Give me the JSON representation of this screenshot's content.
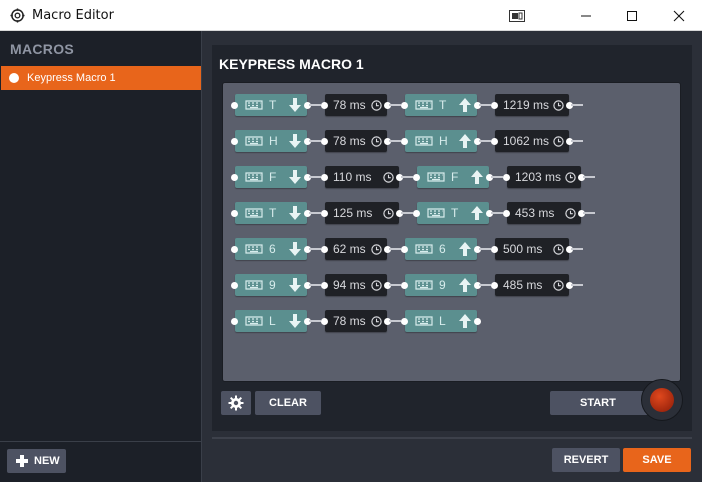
{
  "window": {
    "title": "Macro Editor",
    "icon": "gear-app-icon"
  },
  "sidebar": {
    "title": "MACROS",
    "items": [
      {
        "label": "Keypress Macro 1",
        "selected": true
      }
    ],
    "new_label": "NEW"
  },
  "editor": {
    "title": "KEYPRESS MACRO 1",
    "events": [
      {
        "type": "key",
        "key": "T",
        "dir": "down"
      },
      {
        "type": "delay",
        "label": "78 ms"
      },
      {
        "type": "key",
        "key": "T",
        "dir": "up"
      },
      {
        "type": "delay",
        "label": "1219 ms"
      },
      {
        "type": "key",
        "key": "H",
        "dir": "down"
      },
      {
        "type": "delay",
        "label": "78 ms"
      },
      {
        "type": "key",
        "key": "H",
        "dir": "up"
      },
      {
        "type": "delay",
        "label": "1062 ms"
      },
      {
        "type": "key",
        "key": "F",
        "dir": "down"
      },
      {
        "type": "delay",
        "label": "110 ms"
      },
      {
        "type": "key",
        "key": "F",
        "dir": "up"
      },
      {
        "type": "delay",
        "label": "1203 ms"
      },
      {
        "type": "key",
        "key": "T",
        "dir": "down"
      },
      {
        "type": "delay",
        "label": "125 ms"
      },
      {
        "type": "key",
        "key": "T",
        "dir": "up"
      },
      {
        "type": "delay",
        "label": "453 ms"
      },
      {
        "type": "key",
        "key": "6",
        "dir": "down"
      },
      {
        "type": "delay",
        "label": "62 ms"
      },
      {
        "type": "key",
        "key": "6",
        "dir": "up"
      },
      {
        "type": "delay",
        "label": "500 ms"
      },
      {
        "type": "key",
        "key": "9",
        "dir": "down"
      },
      {
        "type": "delay",
        "label": "94 ms"
      },
      {
        "type": "key",
        "key": "9",
        "dir": "up"
      },
      {
        "type": "delay",
        "label": "485 ms"
      },
      {
        "type": "key",
        "key": "L",
        "dir": "down"
      },
      {
        "type": "delay",
        "label": "78 ms"
      },
      {
        "type": "key",
        "key": "L",
        "dir": "up"
      }
    ],
    "clear_label": "CLEAR",
    "start_label": "START"
  },
  "footer": {
    "revert_label": "REVERT",
    "save_label": "SAVE"
  },
  "colors": {
    "accent": "#e8651b",
    "key_block": "#5b8f8f",
    "delay_block": "#1f2126",
    "canvas": "#5b5f6c",
    "sidebar": "#1c2028"
  }
}
